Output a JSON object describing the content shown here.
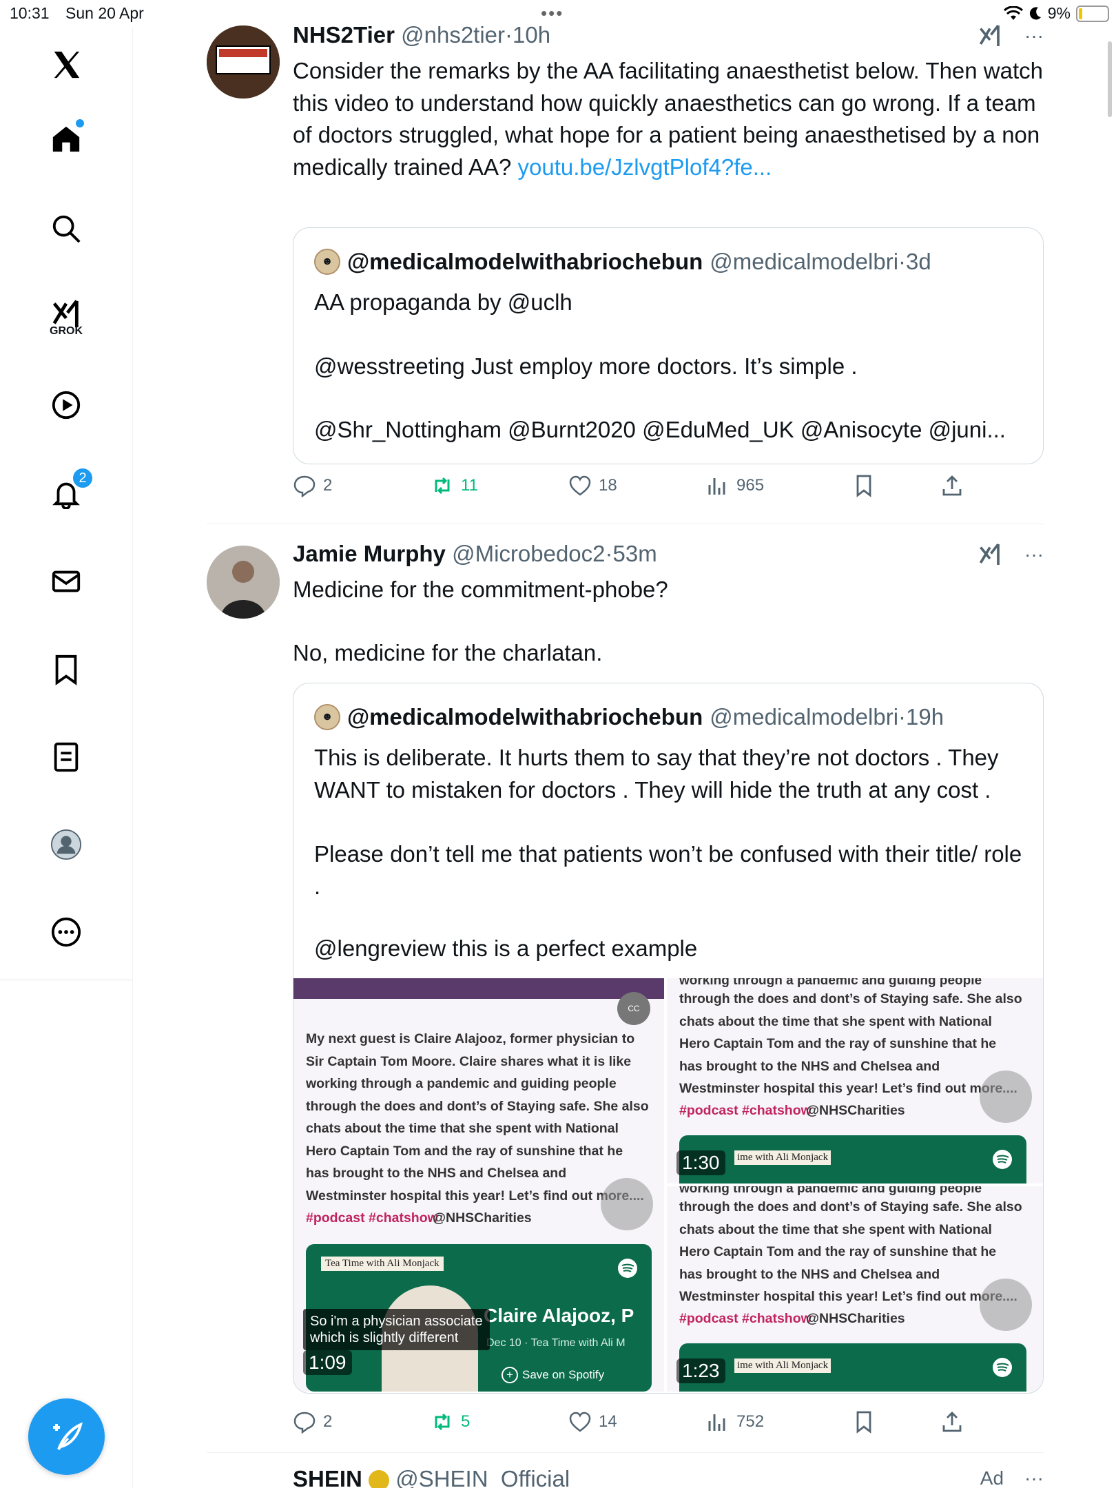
{
  "status_bar": {
    "time": "10:31",
    "date": "Sun 20 Apr",
    "battery": "9%"
  },
  "sidebar": {
    "grok_label": "GROK",
    "notifications_count": "2"
  },
  "posts": [
    {
      "name": "NHS2Tier",
      "handle": "@nhs2tier",
      "sep": "·",
      "time": "10h",
      "text": "Consider the remarks by the AA facilitating anaesthetist below. Then watch this video to understand how quickly anaesthetics can go wrong. If a team of doctors struggled, what hope for a patient being anaesthetised by a non medically trained AA?",
      "link": "youtu.be/JzlvgtPlof4?fe...",
      "quote": {
        "name": "@medicalmodelwithabriochebun",
        "handle": "@medicalmodelbri",
        "sep": "·",
        "time": "3d",
        "line1": "AA propaganda by @uclh",
        "line2": "@wesstreeting Just employ more doctors. It’s simple .",
        "line3": "@Shr_Nottingham @Burnt2020 @EduMed_UK @Anisocyte @juni..."
      },
      "actions": {
        "replies": "2",
        "reposts": "11",
        "likes": "18",
        "views": "965"
      }
    },
    {
      "name": "Jamie Murphy",
      "handle": "@Microbedoc2",
      "sep": "·",
      "time": "53m",
      "line1": "Medicine for the commitment-phobe?",
      "line2": "No, medicine for the charlatan.",
      "quote": {
        "name": "@medicalmodelwithabriochebun",
        "handle": "@medicalmodelbri",
        "sep": "·",
        "time": "19h",
        "para1": "This is deliberate. It hurts them to say that they’re not doctors . They WANT to mistaken for doctors . They will hide the truth at any cost .",
        "para2": "Please don’t tell me that patients won’t be confused with their title/ role .",
        "para3": "@lengreview this is a perfect example"
      },
      "media": {
        "left_desc": "My next guest is Claire Alajooz, former physician to\nSir Captain Tom Moore. Claire shares what it is like\nworking through a pandemic and guiding people\nthrough the does and dont’s of Staying safe. She also\nchats about the time that she spent with National\nHero Captain Tom and the ray of sunshine that he\nhas brought to the NHS and Chelsea and\nWestminster hospital this year! Let’s find out more....",
        "tags": "#podcast #chatshow",
        "mention": "@NHSCharities",
        "right_top": "working through a pandemic and guiding people",
        "right_desc": "through the does and dont’s of Staying safe. She also\nchats about the time that she spent with National\nHero Captain Tom and the ray of sunshine that he\nhas brought to the NHS and Chelsea and\nWestminster hospital this year! Let’s find out more....",
        "card_title": "Tea Time with Ali Monjack",
        "card_name": "Claire Alajooz, P",
        "card_date": "Dec 10 · Tea Time with Ali M",
        "card_save": "Save on Spotify",
        "caption": "So i'm a physician associate\nwhich is slightly different",
        "cc": "CC",
        "d1": "1:09",
        "d2": "1:30",
        "d3": "1:23",
        "small_label": "ime with Ali Monjack"
      },
      "actions": {
        "replies": "2",
        "reposts": "5",
        "likes": "14",
        "views": "752"
      }
    },
    {
      "name": "SHEIN",
      "handle": "@SHEIN_Official",
      "ad": "Ad"
    }
  ]
}
